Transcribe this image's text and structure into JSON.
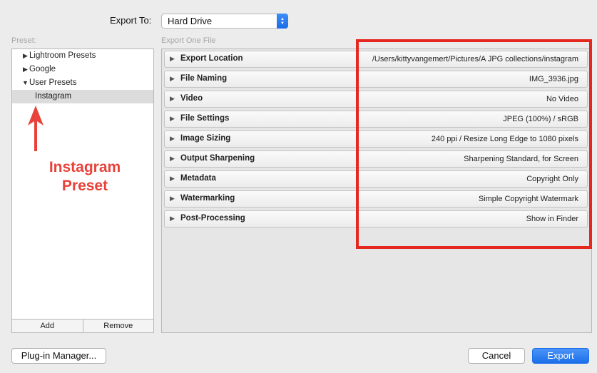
{
  "header": {
    "export_to_label": "Export To:",
    "destination": "Hard Drive"
  },
  "preset_panel": {
    "label": "Preset:",
    "items": [
      {
        "label": "Lightroom Presets",
        "expanded": false
      },
      {
        "label": "Google",
        "expanded": false
      },
      {
        "label": "User Presets",
        "expanded": true
      },
      {
        "label": "Instagram",
        "selected": true
      }
    ],
    "add_label": "Add",
    "remove_label": "Remove"
  },
  "annotation": {
    "line1": "Instagram",
    "line2": "Preset",
    "color": "#e8423a"
  },
  "export_panel": {
    "label": "Export One File",
    "sections": [
      {
        "title": "Export Location",
        "summary": "/Users/kittyvangemert/Pictures/A JPG collections/instagram"
      },
      {
        "title": "File Naming",
        "summary": "IMG_3936.jpg"
      },
      {
        "title": "Video",
        "summary": "No Video"
      },
      {
        "title": "File Settings",
        "summary": "JPEG (100%) / sRGB"
      },
      {
        "title": "Image Sizing",
        "summary": "240 ppi / Resize Long Edge to 1080 pixels"
      },
      {
        "title": "Output Sharpening",
        "summary": "Sharpening Standard, for Screen"
      },
      {
        "title": "Metadata",
        "summary": "Copyright Only"
      },
      {
        "title": "Watermarking",
        "summary": "Simple Copyright Watermark"
      },
      {
        "title": "Post-Processing",
        "summary": "Show in Finder"
      }
    ],
    "highlight_color": "#e42820"
  },
  "footer": {
    "plugin_manager_label": "Plug-in Manager...",
    "cancel_label": "Cancel",
    "export_label": "Export"
  },
  "icons": {
    "expand": "triangle-right-icon",
    "collapse": "triangle-down-icon"
  }
}
